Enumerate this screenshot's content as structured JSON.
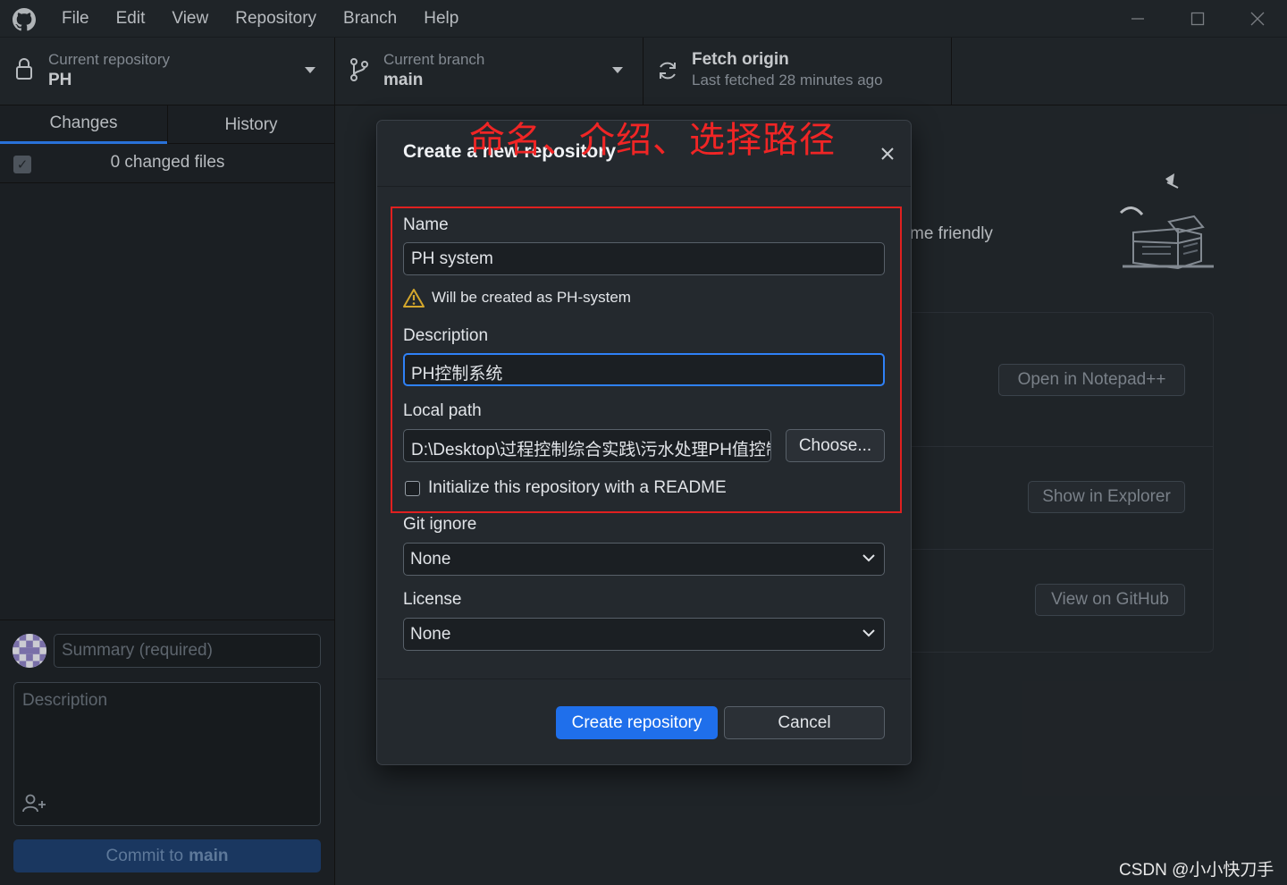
{
  "menu": [
    "File",
    "Edit",
    "View",
    "Repository",
    "Branch",
    "Help"
  ],
  "toolbar": {
    "repo_label": "Current repository",
    "repo_value": "PH",
    "branch_label": "Current branch",
    "branch_value": "main",
    "fetch_title": "Fetch origin",
    "fetch_sub": "Last fetched 28 minutes ago"
  },
  "sidebar": {
    "tabs": [
      "Changes",
      "History"
    ],
    "changed_files": "0 changed files",
    "summary_placeholder": "Summary (required)",
    "description_placeholder": "Description",
    "commit_prefix": "Commit to",
    "commit_branch": "main"
  },
  "main": {
    "friendly_text": "me friendly",
    "actions": [
      "Open in Notepad++",
      "Show in Explorer",
      "View on GitHub"
    ]
  },
  "modal": {
    "title": "Create a new repository",
    "name_label": "Name",
    "name_value": "PH system",
    "warning": "Will be created as PH-system",
    "description_label": "Description",
    "description_value": "PH控制系统",
    "local_path_label": "Local path",
    "local_path_value": "D:\\Desktop\\过程控制综合实践\\污水处理PH值控制",
    "choose_label": "Choose...",
    "readme_label": "Initialize this repository with a README",
    "gitignore_label": "Git ignore",
    "gitignore_value": "None",
    "license_label": "License",
    "license_value": "None",
    "create_label": "Create repository",
    "cancel_label": "Cancel"
  },
  "annotation": "命名、介绍、选择路径",
  "watermark": "CSDN @小小快刀手",
  "colors": {
    "accent": "#1f6feb",
    "annotation": "#e02020",
    "warning": "#d4a72c"
  },
  "icons": [
    "github-logo-icon",
    "lock-icon",
    "branch-icon",
    "sync-icon",
    "close-icon",
    "warning-icon",
    "chevron-down-icon",
    "add-coauthor-icon"
  ]
}
